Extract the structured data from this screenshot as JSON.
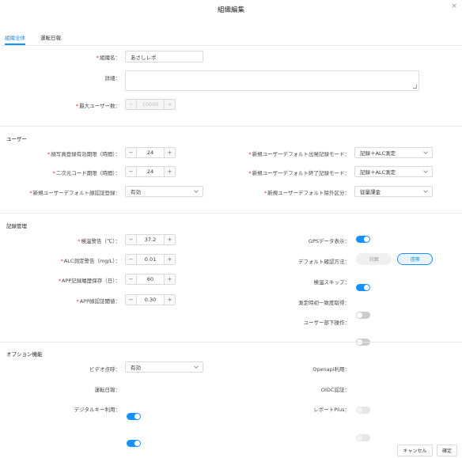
{
  "dialog": {
    "title": "組織編集",
    "close_symbol": "×"
  },
  "tabs": [
    {
      "label": "組織全体",
      "active": true
    },
    {
      "label": "運転日報",
      "active": false
    }
  ],
  "org": {
    "name_label": "組織名：",
    "name_value": "あさしレポ",
    "detail_label": "詳細：",
    "detail_value": "",
    "maxusers_label": "最大ユーザー数：",
    "maxusers_value": "10000",
    "minus": "−",
    "plus": "+"
  },
  "user_section": {
    "title": "ユーザー",
    "photo_label": "顔写真登録有効期限（時間）：",
    "photo_value": "24",
    "qr_label": "二次元コード期限（時間）：",
    "qr_value": "24",
    "auth_label": "新規ユーザーデフォルト顔認証登録：",
    "auth_value": "有効",
    "start_label": "新規ユーザーデフォルト出発記録モード：",
    "start_value": "記録＋ALC測定",
    "end_label": "新規ユーザーデフォルト終了記録モード：",
    "end_value": "記録＋ALC測定",
    "exempt_label": "新規ユーザーデフォルト除外区分：",
    "exempt_value": "従量課金"
  },
  "record_section": {
    "title": "記録管理",
    "temp_label": "検温警告（℃）：",
    "temp_value": "37.2",
    "alc_label": "ALC測定警告（mg/L）：",
    "alc_value": "0.01",
    "app_keep_label": "APP記録履歴保存（日）：",
    "app_keep_value": "60",
    "app_face_label": "APP顔認証閾値：",
    "app_face_value": "0.30",
    "gps_label": "GPSデータ表示：",
    "gps_on": true,
    "confirm_label": "デフォルト確認方法：",
    "confirm_face": "対面",
    "confirm_remote": "遠隔",
    "temp_skip_label": "検温スキップ：",
    "temp_skip_on": true,
    "fetch_label": "測定時初一致度取得：",
    "fetch_on": false,
    "subordinate_label": "ユーザー部下操作：",
    "subordinate_on": false
  },
  "option_section": {
    "title": "オプション機能",
    "video_label": "ビデオ点呼：",
    "video_value": "有効",
    "daily_label": "運転日報：",
    "daily_on": true,
    "digitalkey_label": "デジタルキー利用：",
    "digitalkey_on": true,
    "openapi_label": "Openapi利用：",
    "openapi_on": false,
    "oidc_label": "OIDC認証：",
    "oidc_on": false,
    "reportplus_label": "レポートPlus：",
    "reportplus_on": false
  },
  "footer": {
    "cancel": "キャンセル",
    "confirm": "確定"
  },
  "colors": {
    "accent": "#1890ff",
    "required": "#f5222d"
  }
}
